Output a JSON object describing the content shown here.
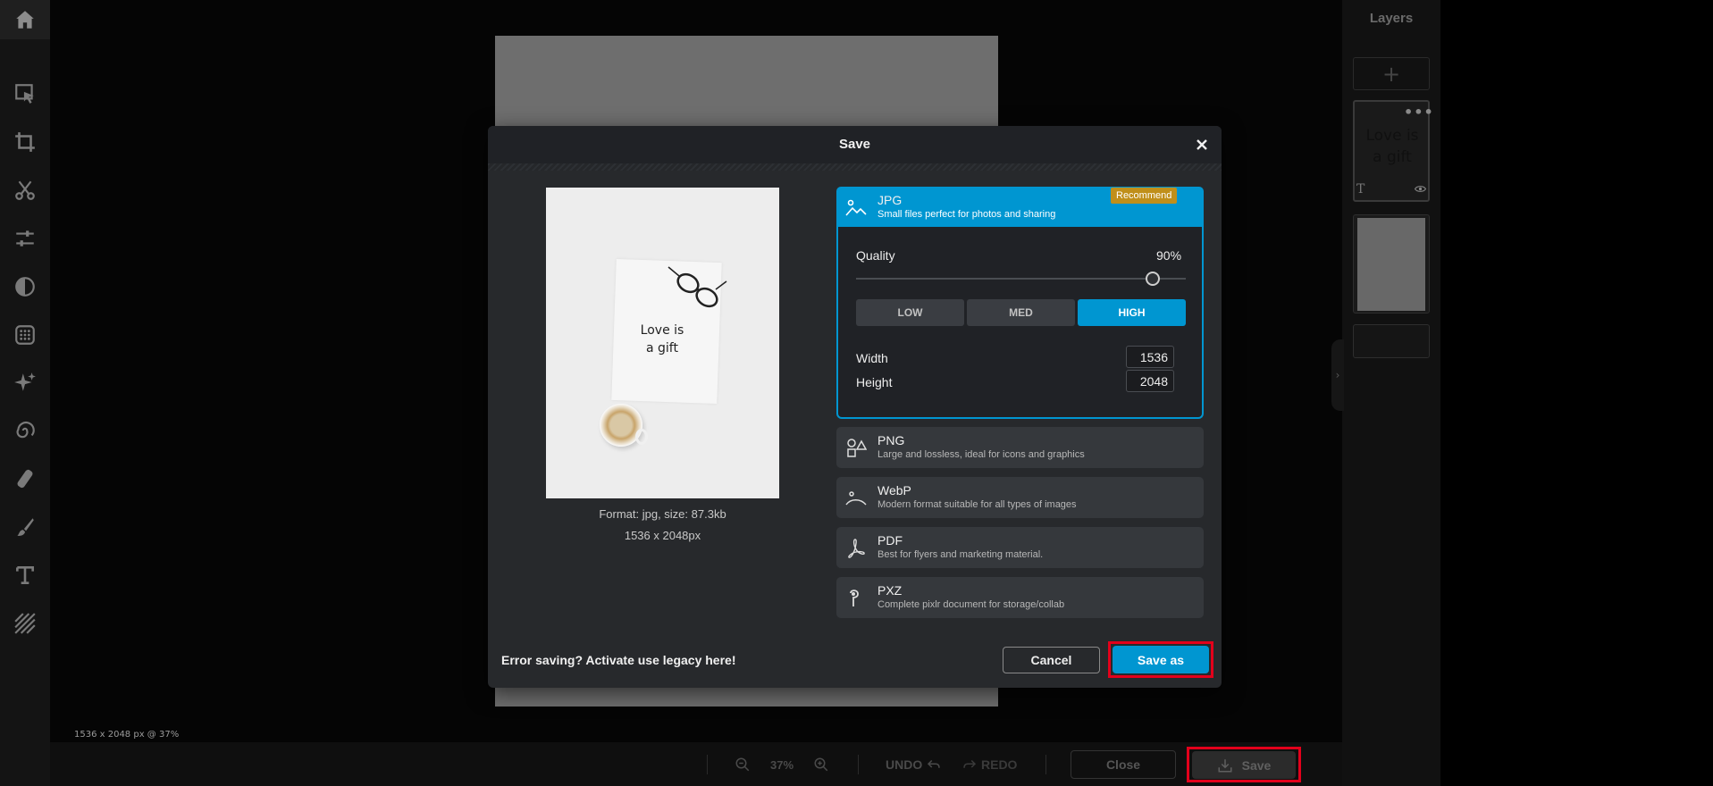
{
  "toolbar": {
    "items": [
      "home-icon",
      "arrange-icon",
      "crop-icon",
      "cutout-icon",
      "adjust-icon",
      "filter-icon",
      "effect-icon",
      "ai-icon",
      "liquify-icon",
      "heal-icon",
      "draw-icon",
      "text-icon",
      "pattern-icon"
    ]
  },
  "workspace": {
    "status": "1536 x 2048 px @ 37%"
  },
  "bottombar": {
    "zoom": "37%",
    "undo": "UNDO",
    "redo": "REDO",
    "close": "Close",
    "save": "Save"
  },
  "layers": {
    "title": "Layers",
    "add": "+",
    "text_layer_preview": "Love is a gift",
    "menu": "•••"
  },
  "modal": {
    "title": "Save",
    "preview": {
      "text_line1": "Love is",
      "text_line2": "a gift",
      "format_info": "Format: jpg, size: 87.3kb",
      "dimensions_info": "1536 x 2048px"
    },
    "formats": [
      {
        "name": "JPG",
        "desc": "Small files perfect for photos and sharing",
        "badge": "Recommend",
        "icon": "image-icon"
      },
      {
        "name": "PNG",
        "desc": "Large and lossless, ideal for icons and graphics",
        "icon": "shapes-icon"
      },
      {
        "name": "WebP",
        "desc": "Modern format suitable for all types of images",
        "icon": "webp-icon"
      },
      {
        "name": "PDF",
        "desc": "Best for flyers and marketing material.",
        "icon": "pdf-icon"
      },
      {
        "name": "PXZ",
        "desc": "Complete pixlr document for storage/collab",
        "icon": "pxz-icon"
      }
    ],
    "jpg_options": {
      "quality_label": "Quality",
      "quality_value": "90%",
      "quality_fraction": 0.9,
      "presets": [
        "LOW",
        "MED",
        "HIGH"
      ],
      "active_preset": "HIGH",
      "width_label": "Width",
      "width_value": "1536",
      "height_label": "Height",
      "height_value": "2048"
    },
    "legacy_text": "Error saving? Activate use legacy here!",
    "cancel": "Cancel",
    "save_as": "Save as"
  },
  "colors": {
    "accent": "#0096d1",
    "highlight": "#e3001b",
    "badge": "#c08f1a"
  }
}
